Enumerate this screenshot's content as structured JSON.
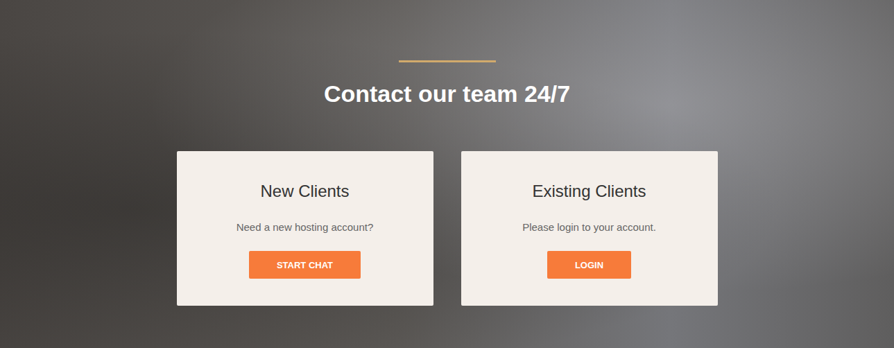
{
  "heading": "Contact our team 24/7",
  "cards": [
    {
      "title": "New Clients",
      "text": "Need a new hosting account?",
      "button": "START CHAT"
    },
    {
      "title": "Existing Clients",
      "text": "Please login to your account.",
      "button": "LOGIN"
    }
  ]
}
